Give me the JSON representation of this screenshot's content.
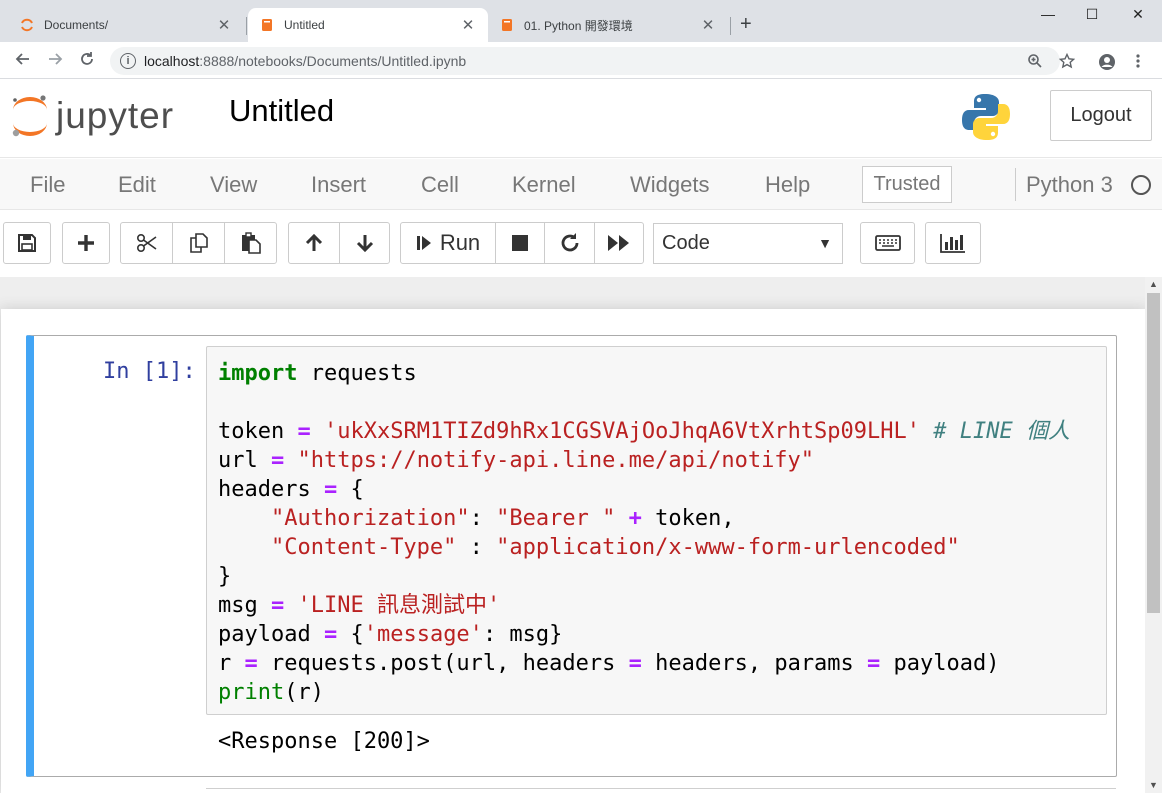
{
  "browser": {
    "tabs": [
      {
        "title": "Documents/",
        "active": false
      },
      {
        "title": "Untitled",
        "active": true
      },
      {
        "title": "01. Python 開發環境",
        "active": false
      }
    ],
    "new_tab_glyph": "+",
    "close_glyph": "✕",
    "window": {
      "minimize": "—",
      "maximize": "☐",
      "close": "✕"
    },
    "url_host": "localhost",
    "url_rest": ":8888/notebooks/Documents/Untitled.ipynb",
    "accent_color": "#f37626"
  },
  "jupyter": {
    "logo_text": "jupyter",
    "notebook_title": "Untitled",
    "logout_label": "Logout",
    "menu": [
      "File",
      "Edit",
      "View",
      "Insert",
      "Cell",
      "Kernel",
      "Widgets",
      "Help"
    ],
    "trusted_label": "Trusted",
    "kernel_name": "Python 3",
    "run_label": "Run",
    "cell_type": "Code"
  },
  "cell": {
    "prompt": "In [1]:",
    "code_lines": [
      "import requests",
      "",
      "token = 'ukXxSRM1TIZd9hRx1CGSVAjOoJhqA6VtXrhtSp09LHL' # LINE 個人",
      "url = \"https://notify-api.line.me/api/notify\"",
      "headers = {",
      "    \"Authorization\": \"Bearer \" + token,",
      "    \"Content-Type\" : \"application/x-www-form-urlencoded\"",
      "}",
      "msg = 'LINE 訊息測試中'",
      "payload = {'message': msg}",
      "r = requests.post(url, headers = headers, params = payload)",
      "print(r)"
    ],
    "output": "<Response [200]>",
    "selected_border_color": "#42a5f5"
  }
}
